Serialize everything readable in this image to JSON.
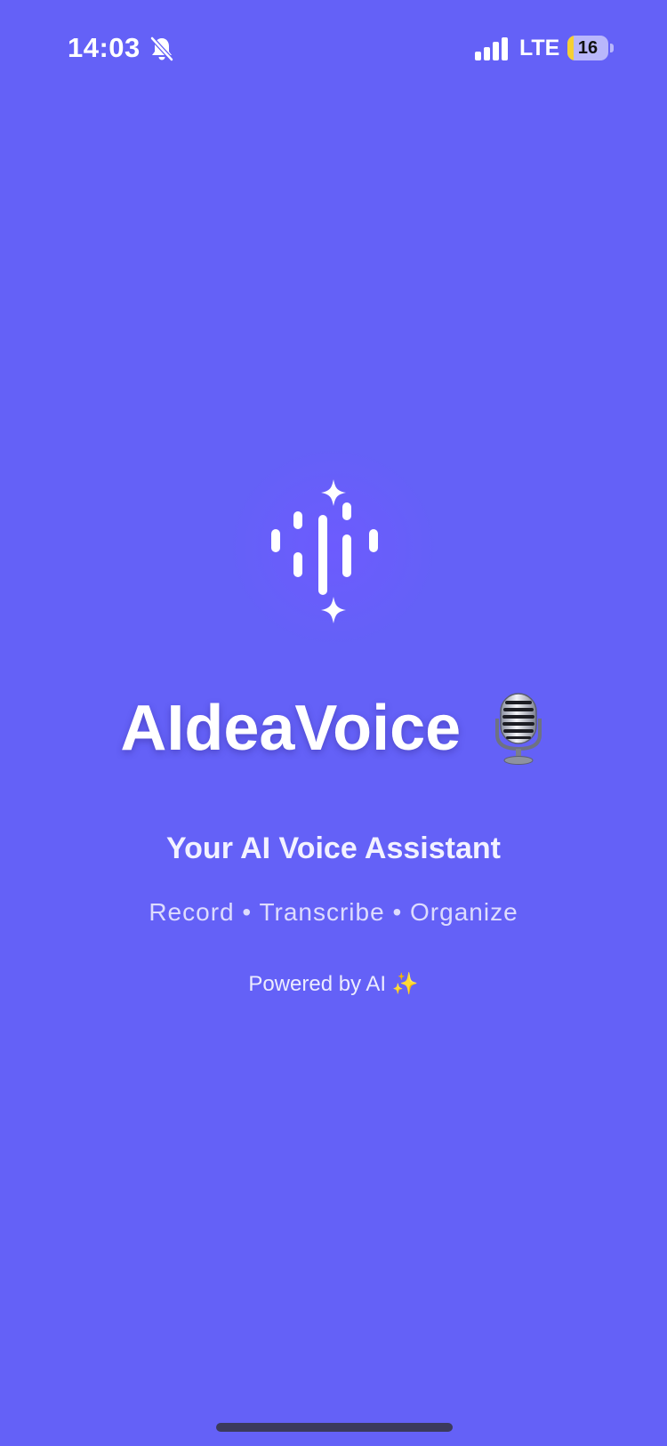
{
  "status_bar": {
    "time": "14:03",
    "network": "LTE",
    "battery_level": "16",
    "battery_fraction": 0.16,
    "battery_color": "#F5D033",
    "icons": [
      "bell-slash-icon",
      "signal-bars-icon",
      "battery-icon"
    ]
  },
  "splash": {
    "logo_icon": "voice-waveform-sparkle-icon",
    "app_name": "AIdeaVoice",
    "title_emoji_icon": "studio-microphone-icon",
    "tagline": "Your AI Voice Assistant",
    "features": "Record • Transcribe • Organize",
    "powered_text": "Powered by AI",
    "powered_emoji": "✨"
  },
  "colors": {
    "background": "#6461F7",
    "text": "#FFFFFF",
    "home_indicator": "#3B3A5C"
  }
}
